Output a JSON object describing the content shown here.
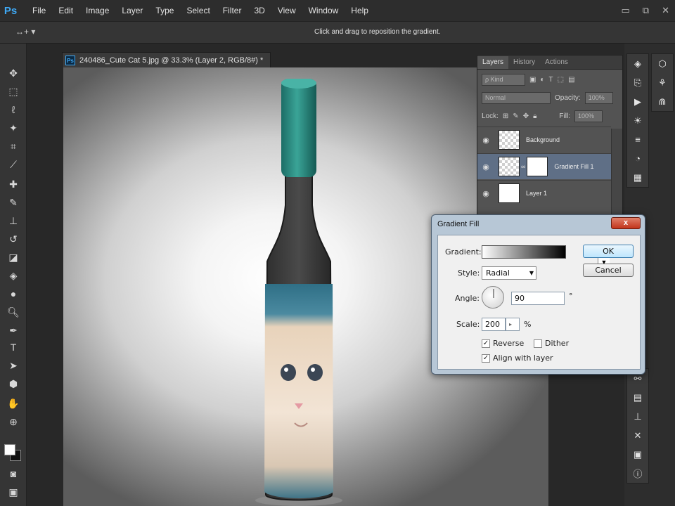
{
  "app": {
    "logo": "Ps"
  },
  "menu": [
    "File",
    "Edit",
    "Image",
    "Layer",
    "Type",
    "Select",
    "Filter",
    "3D",
    "View",
    "Window",
    "Help"
  ],
  "window_controls": {
    "minimize": "▭",
    "restore": "⧉",
    "close": "✕"
  },
  "options_bar": {
    "tool_preset": "↔+ ▾",
    "hint": "Click and drag to reposition the gradient."
  },
  "document": {
    "tab_icon": "Ps",
    "tab_title": "240486_Cute Cat 5.jpg @ 33.3% (Layer 2, RGB/8#) *"
  },
  "layers_panel": {
    "tabs": [
      "Layers",
      "History",
      "Actions"
    ],
    "kind_label": "ρ Kind",
    "blend_mode": "Normal",
    "opacity_label": "Opacity:",
    "opacity_value": "100%",
    "lock_label": "Lock:",
    "fill_label": "Fill:",
    "fill_value": "100%",
    "layers": [
      {
        "name": "Background",
        "selected": false
      },
      {
        "name": "Gradient Fill 1",
        "selected": true
      },
      {
        "name": "Layer 1",
        "selected": false
      }
    ]
  },
  "dialog": {
    "title": "Gradient Fill",
    "close_label": "x",
    "gradient_label": "Gradient:",
    "style_label": "Style:",
    "style_value": "Radial",
    "angle_label": "Angle:",
    "angle_value": "90",
    "angle_unit": "°",
    "scale_label": "Scale:",
    "scale_value": "200",
    "scale_unit": "%",
    "reverse_label": "Reverse",
    "reverse_checked": true,
    "dither_label": "Dither",
    "dither_checked": false,
    "align_label": "Align with layer",
    "align_checked": true,
    "ok_label": "OK",
    "cancel_label": "Cancel"
  },
  "colors": {
    "accent": "#3fa9f5",
    "bottle_cap": "#2a8a80",
    "selected_layer": "#5f6f86"
  }
}
